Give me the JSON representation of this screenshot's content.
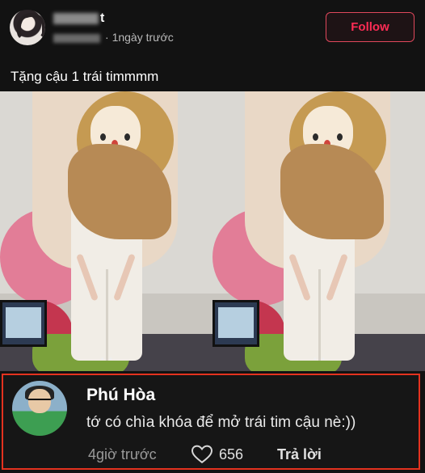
{
  "post": {
    "username_suffix": "t",
    "time": "1ngày trước",
    "follow_label": "Follow",
    "caption": "Tặng cậu 1 trái timmmm"
  },
  "media": {
    "pager_dots": "• •"
  },
  "comment": {
    "author": "Phú Hòa",
    "text": "tớ có chìa khóa để mở trái tim cậu nè:))",
    "time": "4giờ trước",
    "likes": "656",
    "reply_label": "Trả lời"
  },
  "colors": {
    "follow": "#fe2c55",
    "highlight_border": "#e4321f",
    "background": "#121212"
  }
}
